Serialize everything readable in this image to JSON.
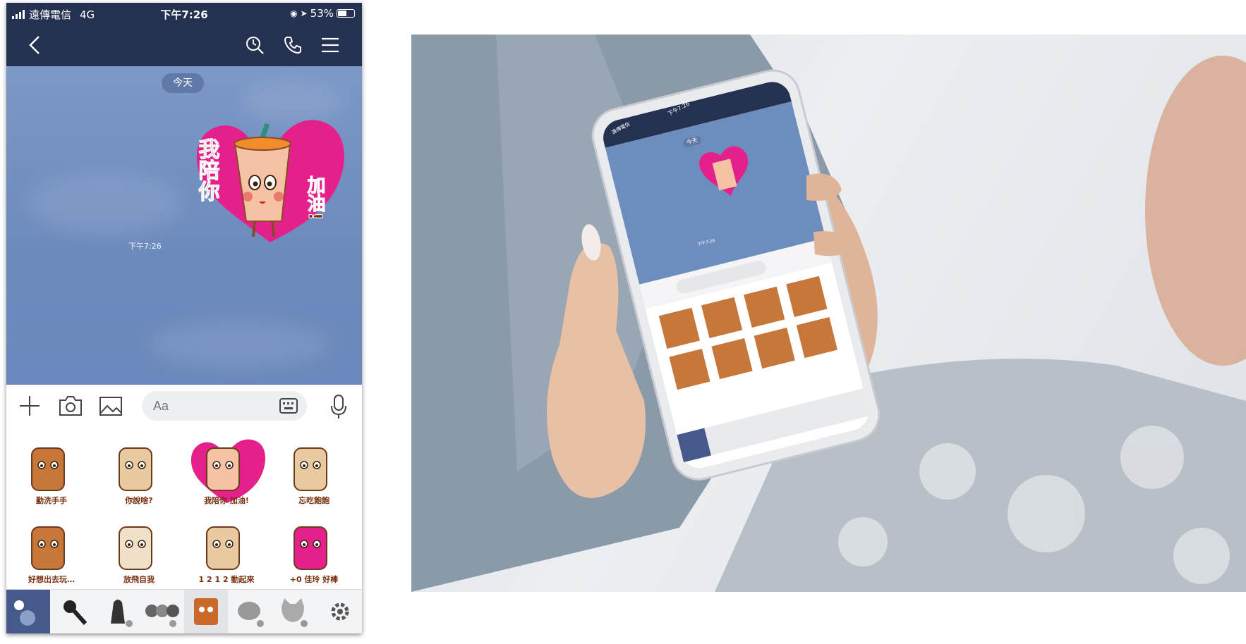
{
  "status_bar": {
    "carrier": "遠傳電信",
    "network": "4G",
    "time": "下午7:26",
    "battery": "53%"
  },
  "chat": {
    "date_label": "今天",
    "message_time": "下午7:26",
    "sticker_text_left": "我陪你",
    "sticker_text_right": "加油!"
  },
  "input": {
    "placeholder": "Aa"
  },
  "sticker_texts": [
    "勤洗手手",
    "你說啥?",
    "我陪你 加油!",
    "忘吃飽飽",
    "好想出去玩…",
    "放飛自我",
    "1 2 1 2 動起來",
    "+0 佳玲 好棒"
  ],
  "sticker_tabs": [
    "emoji-icon",
    "microphone-sticker",
    "shadow-sticker",
    "faces-sticker",
    "drink-sticker",
    "bear-sticker",
    "cat-sticker",
    "settings-icon"
  ],
  "colors": {
    "header": "#253151",
    "chat_bg": "#6e8dbf",
    "heart": "#e5208a",
    "cup": "#f3b98f"
  }
}
